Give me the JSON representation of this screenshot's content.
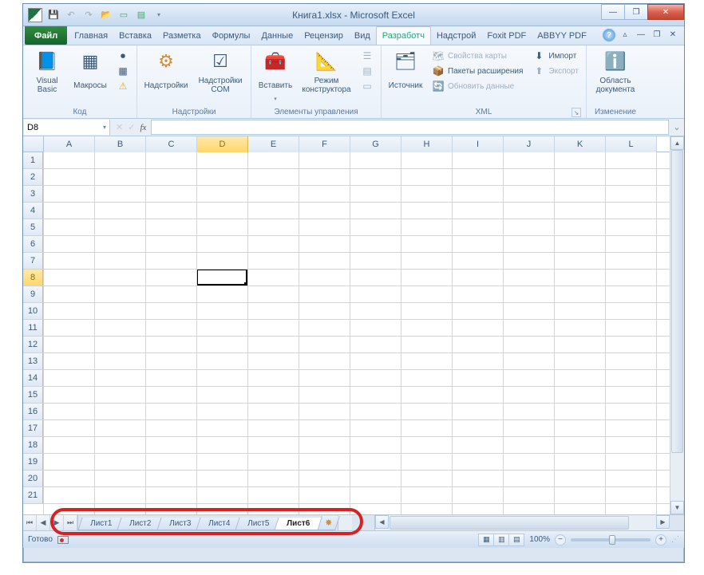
{
  "window": {
    "title": "Книга1.xlsx - Microsoft Excel"
  },
  "menubar": {
    "file": "Файл",
    "tabs": [
      "Главная",
      "Вставка",
      "Разметка",
      "Формулы",
      "Данные",
      "Рецензир",
      "Вид",
      "Разработч",
      "Надстрой",
      "Foxit PDF",
      "ABBYY PDF"
    ],
    "active_index": 7
  },
  "ribbon": {
    "groups": {
      "code": {
        "label": "Код",
        "visual_basic": "Visual Basic",
        "macros": "Макросы"
      },
      "addins": {
        "label": "Надстройки",
        "addins": "Надстройки",
        "com": "Надстройки COM"
      },
      "controls": {
        "label": "Элементы управления",
        "insert": "Вставить",
        "design": "Режим конструктора"
      },
      "xml": {
        "label": "XML",
        "source": "Источник",
        "map_props": "Свойства карты",
        "expansion": "Пакеты расширения",
        "refresh": "Обновить данные",
        "import": "Импорт",
        "export": "Экспорт"
      },
      "modify": {
        "label": "Изменение",
        "doc_panel": "Область документа"
      }
    }
  },
  "namebox": {
    "value": "D8",
    "fx": "fx"
  },
  "grid": {
    "columns": [
      "A",
      "B",
      "C",
      "D",
      "E",
      "F",
      "G",
      "H",
      "I",
      "J",
      "K",
      "L"
    ],
    "rows": [
      "1",
      "2",
      "3",
      "4",
      "5",
      "6",
      "7",
      "8",
      "9",
      "10",
      "11",
      "12",
      "13",
      "14",
      "15",
      "16",
      "17",
      "18",
      "19",
      "20",
      "21"
    ],
    "selected_col": "D",
    "selected_row": "8"
  },
  "sheets": {
    "tabs": [
      "Лист1",
      "Лист2",
      "Лист3",
      "Лист4",
      "Лист5",
      "Лист6"
    ],
    "active_index": 5
  },
  "statusbar": {
    "ready": "Готово",
    "zoom": "100%"
  }
}
